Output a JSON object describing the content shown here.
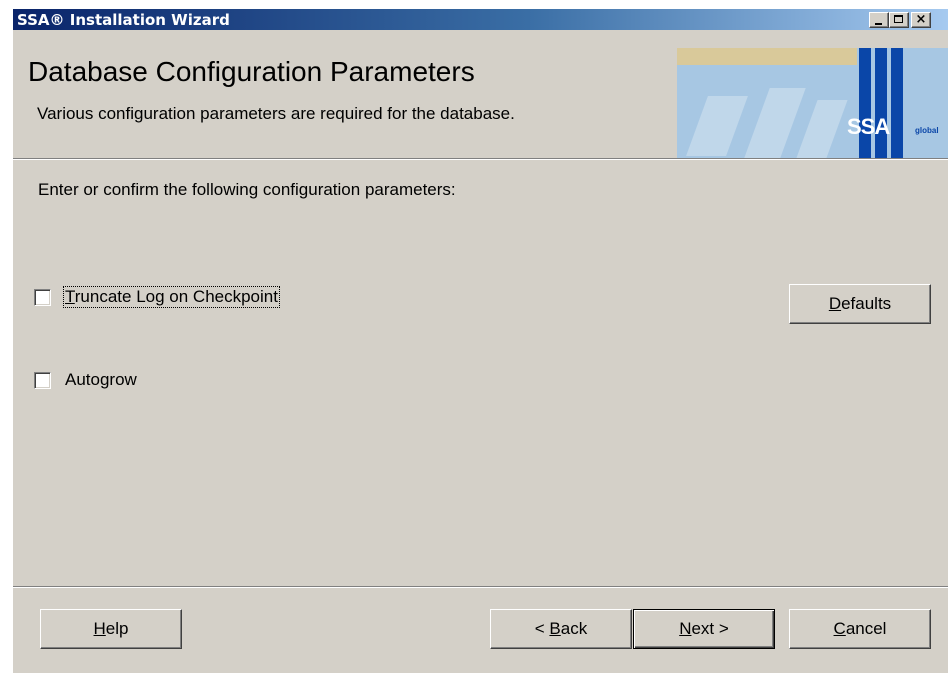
{
  "window": {
    "title": "SSA® Installation Wizard",
    "controls": {
      "minimize": "_",
      "maximize": "□",
      "close": "×"
    }
  },
  "header": {
    "title": "Database Configuration Parameters",
    "subtitle": "Various configuration parameters are required for the database.",
    "logo": {
      "brand": "SSA",
      "tagline": "global"
    }
  },
  "body": {
    "prompt": "Enter or confirm the following configuration parameters:",
    "options": [
      {
        "label_accel": "T",
        "label_rest": "runcate Log on Checkpoint",
        "checked": false,
        "focused": true
      },
      {
        "label_accel": "",
        "label_rest": "Autogrow",
        "checked": false,
        "focused": false
      }
    ],
    "defaults_button": {
      "accel": "D",
      "rest": "efaults"
    }
  },
  "footer": {
    "help": {
      "accel": "H",
      "rest": "elp"
    },
    "back": {
      "prefix": "< ",
      "accel": "B",
      "rest": "ack"
    },
    "next": {
      "accel": "N",
      "rest": "ext >"
    },
    "cancel": {
      "accel": "C",
      "rest": "ancel"
    }
  },
  "colors": {
    "face": "#d4d0c8",
    "titlebar_start": "#0a246a",
    "titlebar_end": "#a6caf0",
    "logo_bg": "#a7c7e3",
    "logo_accent": "#0a46a8"
  }
}
